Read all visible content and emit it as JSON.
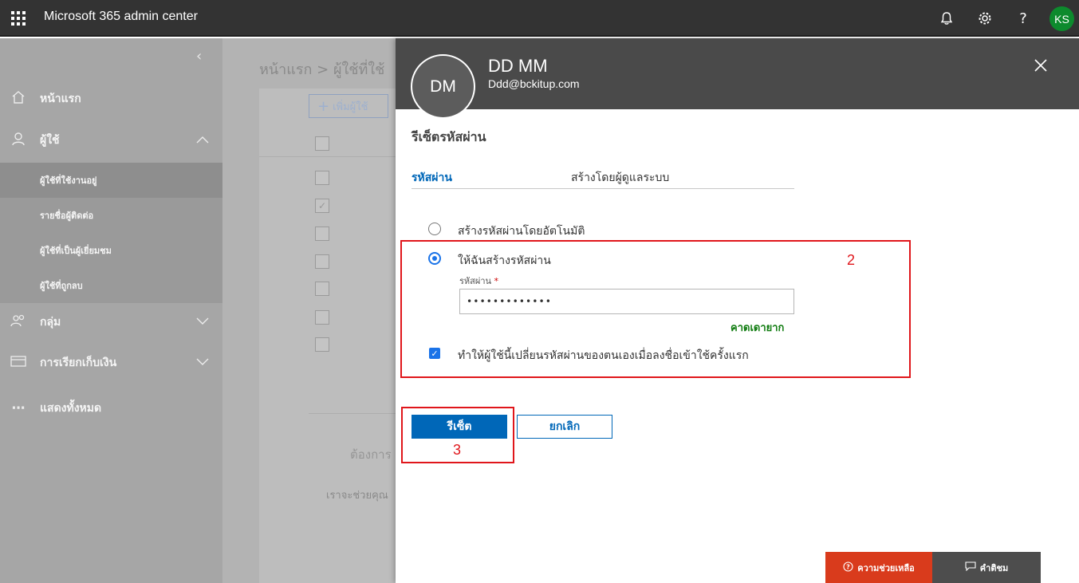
{
  "app": {
    "title": "Microsoft 365 admin center",
    "user_initials": "KS",
    "icons": [
      "waffle-icon",
      "bell-icon",
      "gear-icon",
      "help-icon"
    ]
  },
  "leftnav": {
    "collapse_icon": "chevron-left-icon",
    "items": [
      {
        "label": "หน้าแรก",
        "icon": "home-icon"
      },
      {
        "label": "ผู้ใช้",
        "icon": "user-icon",
        "expanded": true
      },
      {
        "label": "กลุ่ม",
        "icon": "group-icon"
      },
      {
        "label": "การเรียกเก็บเงิน",
        "icon": "card-icon"
      },
      {
        "label": "แสดงทั้งหมด",
        "icon": "ellipsis-icon"
      }
    ],
    "sub_items": [
      {
        "label": "ผู้ใช้ที่ใช้งานอยู่",
        "active": true
      },
      {
        "label": "รายชื่อผู้ติดต่อ"
      },
      {
        "label": "ผู้ใช้ที่เป็นผู้เยี่ยมชม"
      },
      {
        "label": "ผู้ใช้ที่ถูกลบ"
      }
    ]
  },
  "background": {
    "breadcrumb": "หน้าแรก > ผู้ใช้ที่ใช้",
    "add_user": "เพิ่มผู้ใช้",
    "text1": "ต้องการ",
    "text2": "เราจะช่วยคุณ"
  },
  "panel": {
    "initials": "DM",
    "name": "DD MM",
    "email": "Ddd@bckitup.com",
    "section_title": "รีเซ็ตรหัสผ่าน",
    "field_label": "รหัสผ่าน",
    "field_value": "สร้างโดยผู้ดูแลระบบ",
    "option_auto": "สร้างรหัสผ่านโดยอัตโนมัติ",
    "option_manual": "ให้ฉันสร้างรหัสผ่าน",
    "password_label": "รหัสผ่าน",
    "required_mark": "*",
    "password_value": "•••••••••••••",
    "strength": "คาดเดายาก",
    "require_change": "ทำให้ผู้ใช้นี้เปลี่ยนรหัสผ่านของตนเองเมื่อลงชื่อเข้าใช้ครั้งแรก",
    "reset_button": "รีเซ็ต",
    "cancel_button": "ยกเลิก",
    "help_button": "ความช่วยเหลือ",
    "feedback_button": "คำติชม"
  },
  "annotations": {
    "step2": "2",
    "step3": "3",
    "color": "#e0161b"
  }
}
